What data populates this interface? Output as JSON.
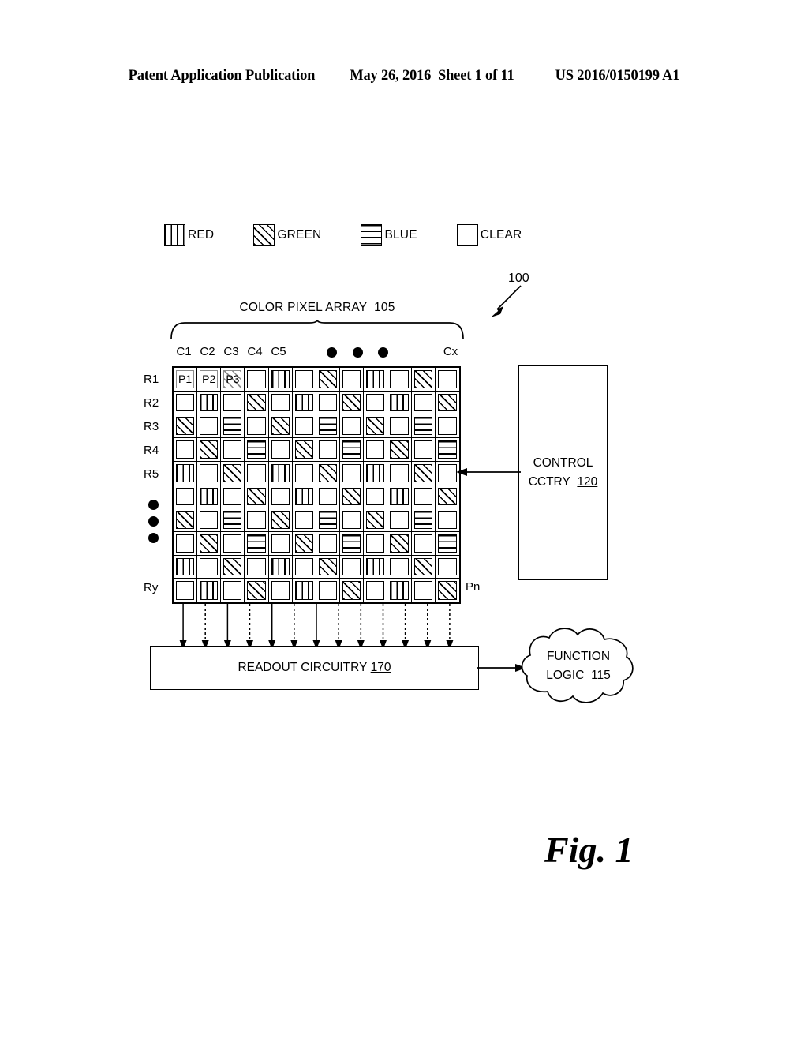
{
  "header": {
    "publication": "Patent Application Publication",
    "date": "May 26, 2016",
    "sheet": "Sheet 1 of 11",
    "number": "US 2016/0150199 A1"
  },
  "legend": {
    "items": [
      {
        "label": "RED",
        "fill": "red",
        "icon": "vertical-lines-swatch"
      },
      {
        "label": "GREEN",
        "fill": "green",
        "icon": "diagonal-hatch-swatch"
      },
      {
        "label": "BLUE",
        "fill": "blue",
        "icon": "horizontal-lines-swatch"
      },
      {
        "label": "CLEAR",
        "fill": "clear",
        "icon": "empty-swatch"
      }
    ]
  },
  "diagram": {
    "system_ref": "100",
    "array": {
      "title": "COLOR PIXEL ARRAY  105",
      "title_text": "COLOR PIXEL ARRAY",
      "title_ref": "105",
      "columns": 12,
      "rows": 10,
      "column_labels": [
        "C1",
        "C2",
        "C3",
        "C4",
        "C5"
      ],
      "column_last_label": "Cx",
      "column_ellipsis": 3,
      "row_labels": [
        "R1",
        "R2",
        "R3",
        "R4",
        "R5"
      ],
      "row_last_label": "Ry",
      "row_ellipsis": 3,
      "pixel_labels": [
        "P1",
        "P2",
        "P3"
      ],
      "last_pixel_label": "Pn",
      "pattern": [
        [
          "clear",
          "clear",
          "green",
          "clear",
          "red",
          "clear",
          "green",
          "clear",
          "red",
          "clear",
          "green",
          "clear"
        ],
        [
          "clear",
          "red",
          "clear",
          "green",
          "clear",
          "red",
          "clear",
          "green",
          "clear",
          "red",
          "clear",
          "green"
        ],
        [
          "green",
          "clear",
          "blue",
          "clear",
          "green",
          "clear",
          "blue",
          "clear",
          "green",
          "clear",
          "blue",
          "clear"
        ],
        [
          "clear",
          "green",
          "clear",
          "blue",
          "clear",
          "green",
          "clear",
          "blue",
          "clear",
          "green",
          "clear",
          "blue"
        ],
        [
          "red",
          "clear",
          "green",
          "clear",
          "red",
          "clear",
          "green",
          "clear",
          "red",
          "clear",
          "green",
          "clear"
        ],
        [
          "clear",
          "red",
          "clear",
          "green",
          "clear",
          "red",
          "clear",
          "green",
          "clear",
          "red",
          "clear",
          "green"
        ],
        [
          "green",
          "clear",
          "blue",
          "clear",
          "green",
          "clear",
          "blue",
          "clear",
          "green",
          "clear",
          "blue",
          "clear"
        ],
        [
          "clear",
          "green",
          "clear",
          "blue",
          "clear",
          "green",
          "clear",
          "blue",
          "clear",
          "green",
          "clear",
          "blue"
        ],
        [
          "red",
          "clear",
          "green",
          "clear",
          "red",
          "clear",
          "green",
          "clear",
          "red",
          "clear",
          "green",
          "clear"
        ],
        [
          "clear",
          "red",
          "clear",
          "green",
          "clear",
          "red",
          "clear",
          "green",
          "clear",
          "red",
          "clear",
          "green"
        ]
      ]
    },
    "control": {
      "line1": "CONTROL",
      "line2": "CCTRY",
      "ref": "120"
    },
    "readout": {
      "label": "READOUT CIRCUITRY",
      "ref": "170",
      "bitline_count": 13
    },
    "function_logic": {
      "line1": "FUNCTION",
      "line2": "LOGIC",
      "ref": "115"
    }
  },
  "caption": "Fig. 1",
  "colors": {
    "ink": "#000000",
    "paper": "#ffffff"
  }
}
